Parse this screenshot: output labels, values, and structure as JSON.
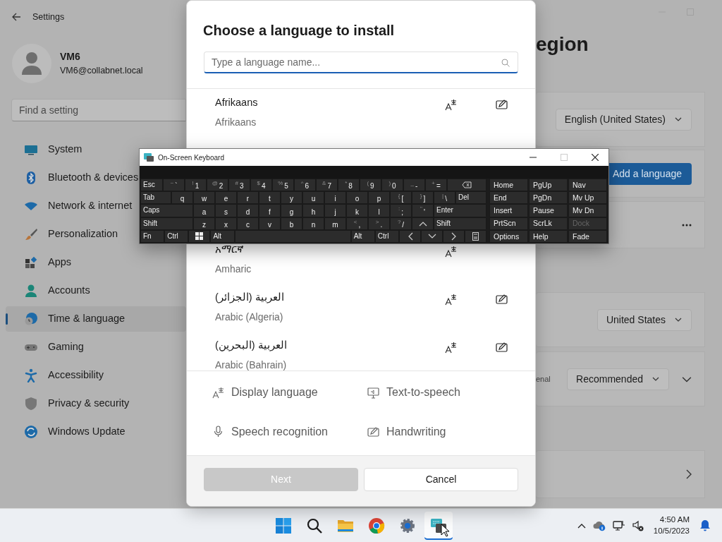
{
  "settings": {
    "title": "Settings",
    "user": {
      "name": "VM6",
      "email": "VM6@collabnet.local"
    },
    "search": {
      "placeholder": "Find a setting"
    },
    "nav": [
      {
        "label": "System",
        "selected": false
      },
      {
        "label": "Bluetooth & devices",
        "selected": false
      },
      {
        "label": "Network & internet",
        "selected": false
      },
      {
        "label": "Personalization",
        "selected": false
      },
      {
        "label": "Apps",
        "selected": false
      },
      {
        "label": "Accounts",
        "selected": false
      },
      {
        "label": "Time & language",
        "selected": true
      },
      {
        "label": "Gaming",
        "selected": false
      },
      {
        "label": "Accessibility",
        "selected": false
      },
      {
        "label": "Privacy & security",
        "selected": false
      },
      {
        "label": "Windows Update",
        "selected": false
      }
    ],
    "page_title": "egion",
    "cards": [
      {
        "kind": "dropdown",
        "value": "English (United States)"
      },
      {
        "kind": "button",
        "label": "Add a language"
      },
      {
        "kind": "more"
      },
      {
        "kind": "dropdown",
        "value": "United States"
      },
      {
        "kind": "dropdown",
        "label": "enal",
        "value": "Recommended",
        "expandable": true
      },
      {
        "kind": "link"
      }
    ]
  },
  "dialog": {
    "title": "Choose a language to install",
    "search": {
      "placeholder": "Type a language name..."
    },
    "languages": [
      {
        "native": "Afrikaans",
        "english": "Afrikaans",
        "display_language": true,
        "handwriting": true
      },
      {
        "native": "አማርኛ",
        "english": "Amharic",
        "display_language": true,
        "handwriting": false
      },
      {
        "native": "العربية (الجزائر)",
        "english": "Arabic (Algeria)",
        "display_language": true,
        "handwriting": true
      },
      {
        "native": "العربية (البحرين)",
        "english": "Arabic (Bahrain)",
        "display_language": true,
        "handwriting": true
      }
    ],
    "legend": [
      {
        "label": "Display language"
      },
      {
        "label": "Text-to-speech"
      },
      {
        "label": "Speech recognition"
      },
      {
        "label": "Handwriting"
      }
    ],
    "buttons": [
      {
        "label": "Next",
        "disabled": true
      },
      {
        "label": "Cancel",
        "disabled": false
      }
    ]
  },
  "keyboard": {
    "title": "On-Screen Keyboard",
    "rows": [
      {
        "keys": [
          {
            "kind": "label",
            "label": "Esc"
          },
          {
            "kind": "char",
            "shift": "~",
            "main": "`"
          },
          {
            "kind": "char",
            "shift": "!",
            "main": "1"
          },
          {
            "kind": "char",
            "shift": "@",
            "main": "2"
          },
          {
            "kind": "char",
            "shift": "#",
            "main": "3"
          },
          {
            "kind": "char",
            "shift": "$",
            "main": "4"
          },
          {
            "kind": "char",
            "shift": "%",
            "main": "5"
          },
          {
            "kind": "char",
            "shift": "^",
            "main": "6"
          },
          {
            "kind": "char",
            "shift": "&",
            "main": "7"
          },
          {
            "kind": "char",
            "shift": "*",
            "main": "8"
          },
          {
            "kind": "char",
            "shift": "(",
            "main": "9"
          },
          {
            "kind": "char",
            "shift": ")",
            "main": "0"
          },
          {
            "kind": "char",
            "shift": "_",
            "main": "-"
          },
          {
            "kind": "char",
            "shift": "+",
            "main": "="
          },
          {
            "kind": "backspace"
          }
        ]
      },
      {
        "keys": [
          {
            "kind": "label",
            "label": "Tab"
          },
          {
            "kind": "char",
            "main": "q"
          },
          {
            "kind": "char",
            "main": "w"
          },
          {
            "kind": "char",
            "main": "e"
          },
          {
            "kind": "char",
            "main": "r"
          },
          {
            "kind": "char",
            "main": "t"
          },
          {
            "kind": "char",
            "main": "y"
          },
          {
            "kind": "char",
            "main": "u"
          },
          {
            "kind": "char",
            "main": "i"
          },
          {
            "kind": "char",
            "main": "o"
          },
          {
            "kind": "char",
            "main": "p"
          },
          {
            "kind": "char",
            "shift": "{",
            "main": "["
          },
          {
            "kind": "char",
            "shift": "}",
            "main": "]"
          },
          {
            "kind": "char",
            "shift": "|",
            "main": "\\"
          },
          {
            "kind": "label",
            "label": "Del"
          }
        ]
      },
      {
        "keys": [
          {
            "kind": "label",
            "label": "Caps"
          },
          {
            "kind": "char",
            "main": "a"
          },
          {
            "kind": "char",
            "main": "s"
          },
          {
            "kind": "char",
            "main": "d"
          },
          {
            "kind": "char",
            "main": "f"
          },
          {
            "kind": "char",
            "main": "g"
          },
          {
            "kind": "char",
            "main": "h"
          },
          {
            "kind": "char",
            "main": "j"
          },
          {
            "kind": "char",
            "main": "k"
          },
          {
            "kind": "char",
            "main": "l"
          },
          {
            "kind": "char",
            "shift": ":",
            "main": ";"
          },
          {
            "kind": "char",
            "shift": "\"",
            "main": "'"
          },
          {
            "kind": "label",
            "label": "Enter"
          }
        ]
      },
      {
        "keys": [
          {
            "kind": "label",
            "label": "Shift"
          },
          {
            "kind": "char",
            "main": "z"
          },
          {
            "kind": "char",
            "main": "x"
          },
          {
            "kind": "char",
            "main": "c"
          },
          {
            "kind": "char",
            "main": "v"
          },
          {
            "kind": "char",
            "main": "b"
          },
          {
            "kind": "char",
            "main": "n"
          },
          {
            "kind": "char",
            "main": "m"
          },
          {
            "kind": "char",
            "shift": "<",
            "main": ","
          },
          {
            "kind": "char",
            "shift": ">",
            "main": "."
          },
          {
            "kind": "char",
            "shift": "?",
            "main": "/"
          },
          {
            "kind": "up"
          },
          {
            "kind": "label",
            "label": "Shift"
          }
        ]
      },
      {
        "keys": [
          {
            "kind": "label",
            "label": "Fn"
          },
          {
            "kind": "label",
            "label": "Ctrl"
          },
          {
            "kind": "windows"
          },
          {
            "kind": "label",
            "label": "Alt"
          },
          {
            "kind": "space"
          },
          {
            "kind": "label",
            "label": "Alt"
          },
          {
            "kind": "label",
            "label": "Ctrl"
          },
          {
            "kind": "left"
          },
          {
            "kind": "down"
          },
          {
            "kind": "right"
          },
          {
            "kind": "menu"
          }
        ]
      }
    ],
    "nav_keys": [
      {
        "label": "Home",
        "disabled": false
      },
      {
        "label": "PgUp",
        "disabled": false
      },
      {
        "label": "Nav",
        "disabled": false
      },
      {
        "label": "End",
        "disabled": false
      },
      {
        "label": "PgDn",
        "disabled": false
      },
      {
        "label": "Mv Up",
        "disabled": false
      },
      {
        "label": "Insert",
        "disabled": false
      },
      {
        "label": "Pause",
        "disabled": false
      },
      {
        "label": "Mv Dn",
        "disabled": false
      },
      {
        "label": "PrtScn",
        "disabled": false
      },
      {
        "label": "ScrLk",
        "disabled": false
      },
      {
        "label": "Dock",
        "disabled": true
      },
      {
        "label": "Options",
        "disabled": false
      },
      {
        "label": "Help",
        "disabled": false
      },
      {
        "label": "Fade",
        "disabled": false
      }
    ]
  },
  "taskbar": {
    "apps": [
      {
        "selected": false
      },
      {
        "selected": false
      },
      {
        "selected": false
      },
      {
        "selected": false
      },
      {
        "selected": false
      },
      {
        "selected": true
      }
    ],
    "clock": {
      "time": "4:50 AM",
      "date": "10/5/2023"
    }
  }
}
